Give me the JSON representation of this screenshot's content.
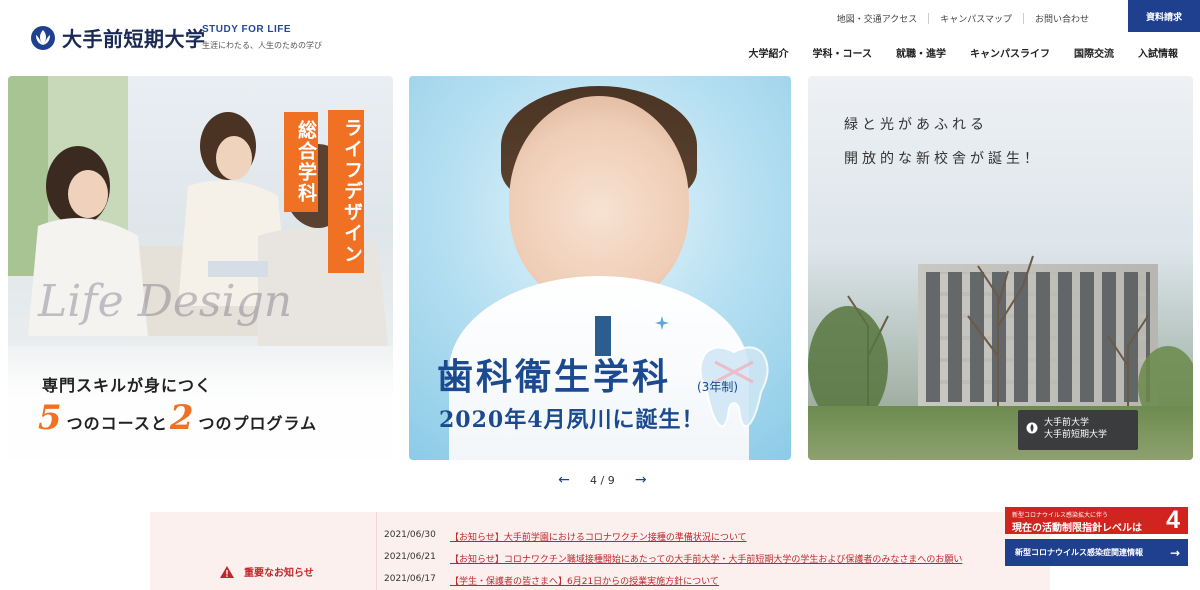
{
  "header": {
    "logo_text": "大手前短期大学",
    "tagline_en": "STUDY FOR LIFE",
    "tagline_jp": "生涯にわたる、人生のための学び",
    "util_links": [
      "地図・交通アクセス",
      "キャンパスマップ",
      "お問い合わせ"
    ],
    "request_label": "資料請求",
    "nav": [
      "大学紹介",
      "学科・コース",
      "就職・進学",
      "キャンパスライフ",
      "国際交流",
      "入試情報"
    ]
  },
  "slides": {
    "s1": {
      "badge1": "総合学科",
      "badge2": "ライフデザイン",
      "script": "Life Design",
      "line1": "専門スキルが身につく",
      "num1": "5",
      "mid1": "つのコースと",
      "num2": "2",
      "mid2": "つのプログラム"
    },
    "s2": {
      "title": "歯科衛生学科",
      "sub": "(3年制)",
      "date": "2020年4月夙川に誕生！"
    },
    "s3": {
      "line1": "緑と光があふれる",
      "line2": "開放的な新校舎が誕生！",
      "sign1": "大手前大学",
      "sign2": "大手前短期大学"
    }
  },
  "pager": {
    "prev": "←",
    "current": "4",
    "separator": "/",
    "total": "9",
    "next": "→"
  },
  "notice": {
    "label": "重要なお知らせ",
    "items": [
      {
        "date": "2021/06/30",
        "text": "【お知らせ】大手前学園におけるコロナワクチン接種の準備状況について"
      },
      {
        "date": "2021/06/21",
        "text": "【お知らせ】コロナワクチン職域接種開始にあたっての大手前大学・大手前短期大学の学生および保護者のみなさまへのお願い"
      },
      {
        "date": "2021/06/17",
        "text": "【学生・保護者の皆さまへ】6月21日からの授業実施方針について"
      }
    ]
  },
  "covid": {
    "small": "新型コロナウイルス感染拡大に伴う",
    "main": "現在の活動制限指針レベルは",
    "level": "4",
    "info": "新型コロナウイルス感染症関連情報",
    "arrow": "→"
  },
  "colors": {
    "brand": "#1f3f8f",
    "accent": "#f07123",
    "alert": "#c0272d"
  }
}
